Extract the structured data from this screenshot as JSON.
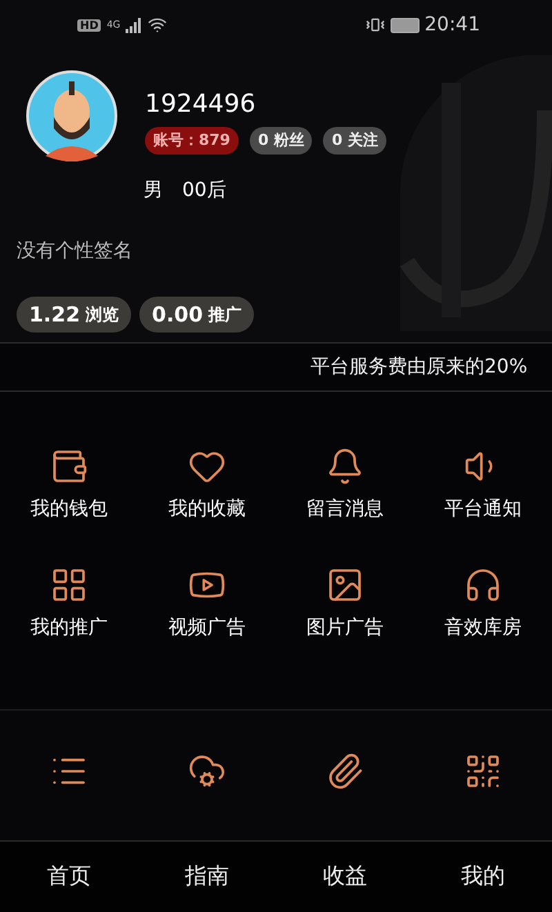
{
  "status_bar": {
    "hd": "HD",
    "network": "4G",
    "time": "20:41"
  },
  "profile": {
    "user_id": "1924496",
    "account_badge": "账号：879",
    "fans": "0 粉丝",
    "following": "0 关注",
    "gender": "男",
    "age_group": "00后",
    "signature": "没有个性签名"
  },
  "stats": [
    {
      "value": "1.22",
      "label": "浏览"
    },
    {
      "value": "0.00",
      "label": "推广"
    }
  ],
  "ticker": "平台服务费由原来的20%",
  "menu": [
    {
      "label": "我的钱包"
    },
    {
      "label": "我的收藏"
    },
    {
      "label": "留言消息"
    },
    {
      "label": "平台通知"
    },
    {
      "label": "我的推广"
    },
    {
      "label": "视频广告"
    },
    {
      "label": "图片广告"
    },
    {
      "label": "音效库房"
    }
  ],
  "tab_bar": [
    {
      "label": "首页"
    },
    {
      "label": "指南"
    },
    {
      "label": "收益"
    },
    {
      "label": "我的"
    }
  ]
}
